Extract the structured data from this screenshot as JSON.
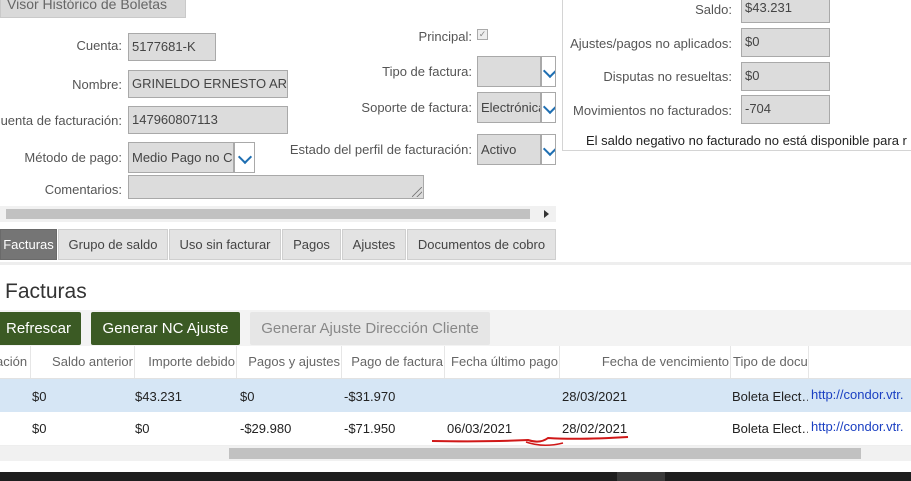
{
  "panel": {
    "title": "Visor Histórico de Boletas",
    "fields": {
      "cuenta": {
        "label": "Cuenta:",
        "value": "5177681-K"
      },
      "nombre": {
        "label": "Nombre:",
        "value": "GRINELDO ERNESTO ARAI"
      },
      "cuenta_facturacion": {
        "label": "Cuenta de facturación:",
        "value": "147960807113"
      },
      "metodo_pago": {
        "label": "Método de pago:",
        "value": "Medio Pago no C"
      },
      "comentarios": {
        "label": "Comentarios:",
        "value": ""
      },
      "principal": {
        "label": "Principal:",
        "checked": true
      },
      "tipo_factura": {
        "label": "Tipo de factura:",
        "value": ""
      },
      "soporte_factura": {
        "label": "Soporte de factura:",
        "value": "Electrónica"
      },
      "estado_perfil": {
        "label": "Estado del perfil de facturación:",
        "value": "Activo"
      }
    }
  },
  "summary": {
    "saldo": {
      "label": "Saldo:",
      "value": "$43.231"
    },
    "ajustes": {
      "label": "Ajustes/pagos no aplicados:",
      "value": "$0"
    },
    "disputas": {
      "label": "Disputas no resueltas:",
      "value": "$0"
    },
    "movimientos": {
      "label": "Movimientos no facturados:",
      "value": "-704"
    },
    "note": "El saldo negativo no facturado no está disponible para r"
  },
  "tabs": [
    {
      "label": "Facturas",
      "active": true
    },
    {
      "label": "Grupo de saldo"
    },
    {
      "label": "Uso sin facturar"
    },
    {
      "label": "Pagos"
    },
    {
      "label": "Ajustes"
    },
    {
      "label": "Documentos de cobro"
    }
  ],
  "section": {
    "title": "Facturas",
    "buttons": {
      "refrescar": "Refrescar",
      "generar_nc": "Generar NC Ajuste",
      "generar_ajuste_dir": "Generar Ajuste Dirección Cliente"
    }
  },
  "table": {
    "headers": [
      "ación",
      "Saldo anterior",
      "Importe debido",
      "Pagos y ajustes",
      "Pago de factura",
      "Fecha último pago",
      "Fecha de vencimiento",
      "Tipo de docu"
    ],
    "rows": [
      [
        "$0",
        "$43.231",
        "$0",
        "-$31.970",
        "",
        "28/03/2021",
        "Boleta Elect…",
        "http://condor.vtr."
      ],
      [
        "$0",
        "$0",
        "-$29.980",
        "-$71.950",
        "06/03/2021",
        "28/02/2021",
        "Boleta Elect…",
        "http://condor.vtr."
      ]
    ]
  },
  "colors": {
    "accent_green": "#3b5a24",
    "selected_row": "#d6e6f5",
    "annotation": "#d01818",
    "tab_active": "#757575"
  }
}
